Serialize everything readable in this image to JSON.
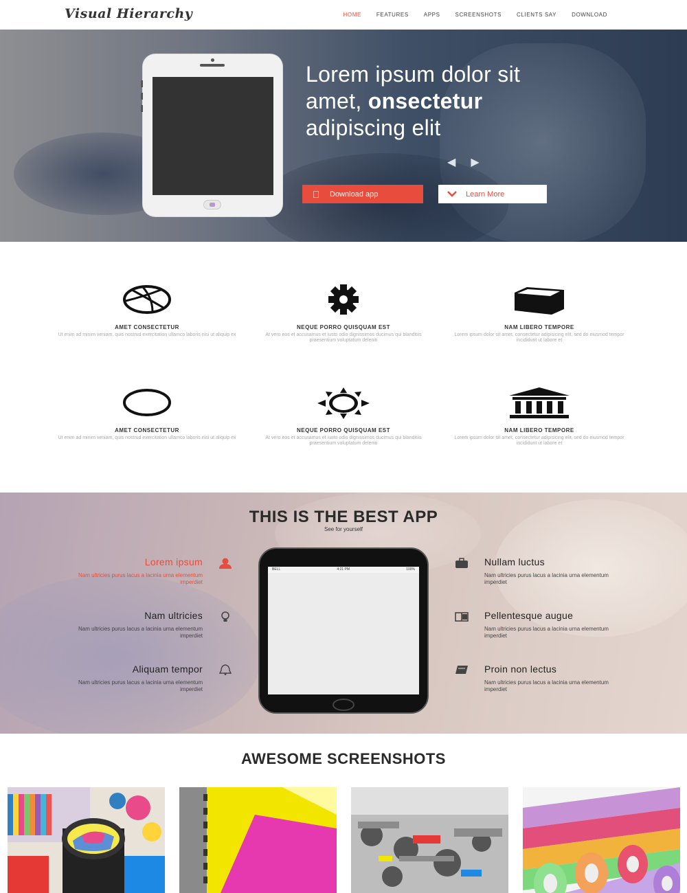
{
  "nav": {
    "logo": "Visual Hierarchy",
    "items": [
      "HOME",
      "FEATURES",
      "APPS",
      "SCREENSHOTS",
      "CLIENTS SAY",
      "DOWNLOAD"
    ],
    "active": "HOME"
  },
  "hero": {
    "title_line1": "Lorem ipsum dolor sit",
    "title_line2_prefix": "amet, ",
    "title_line2_bold": "onsectetur",
    "title_line3": "adipiscing elit",
    "arrows": "‹ ›",
    "download_label": "Download app",
    "learn_label": "Learn More",
    "accent": "#e74c3c"
  },
  "features": [
    {
      "icon": "dribbble-icon",
      "title": "AMET CONSECTETUR",
      "desc": "Ut enim ad minim veniam, quis nostrud exercitation ullamco laboris nisi ut aliquip ex"
    },
    {
      "icon": "gear-icon",
      "title": "NEQUE PORRO QUISQUAM EST",
      "desc": "At vero eos et accusamus et iusto odio dignissimos ducimus qui blanditiis praesentium voluptatum deleniti"
    },
    {
      "icon": "cube-icon",
      "title": "NAM LIBERO TEMPORE",
      "desc": "Lorem ipsum dolor sit amet, consectetur adipisicing elit, sed do eiusmod tempor incididunt ut labore et"
    },
    {
      "icon": "circle-icon",
      "title": "AMET CONSECTETUR",
      "desc": "Ut enim ad minim veniam, quis nostrud exercitation ullamco laboris nisi ut aliquip ex"
    },
    {
      "icon": "sun-icon",
      "title": "NEQUE PORRO QUISQUAM EST",
      "desc": "At vero eos et accusamus et iusto odio dignissimos ducimus qui blanditiis praesentium voluptatum deleniti"
    },
    {
      "icon": "bank-icon",
      "title": "NAM LIBERO TEMPORE",
      "desc": "Lorem ipsum dolor sit amet, consectetur adipisicing elit, sed do eiusmod tempor incididunt ut labore et"
    }
  ],
  "best": {
    "title": "THIS IS THE BEST APP",
    "subtitle": "See for yourself",
    "left": [
      {
        "title": "Lorem ipsum",
        "desc": "Nam ultricies purus lacus a lacinia urna elementum imperdiet",
        "icon": "user-icon"
      },
      {
        "title": "Nam ultricies",
        "desc": "Nam ultricies purus lacus a lacinia urna elementum imperdiet",
        "icon": "lightbulb-icon"
      },
      {
        "title": "Aliquam tempor",
        "desc": "Nam ultricies purus lacus a lacinia urna elementum imperdiet",
        "icon": "bell-icon"
      }
    ],
    "right": [
      {
        "title": "Nullam luctus",
        "desc": "Nam ultricies purus lacus a lacinia urna elementum imperdiet",
        "icon": "briefcase-icon"
      },
      {
        "title": "Pellentesque augue",
        "desc": "Nam ultricies purus lacus a lacinia urna elementum imperdiet",
        "icon": "book-open-icon"
      },
      {
        "title": "Proin non lectus",
        "desc": "Nam ultricies purus lacus a lacinia urna elementum imperdiet",
        "icon": "book-icon"
      }
    ],
    "phone_status": {
      "carrier": "BELL",
      "time": "4:21 PM",
      "battery": "100%"
    }
  },
  "screenshots": {
    "title": "AWESOME SCREENSHOTS"
  }
}
